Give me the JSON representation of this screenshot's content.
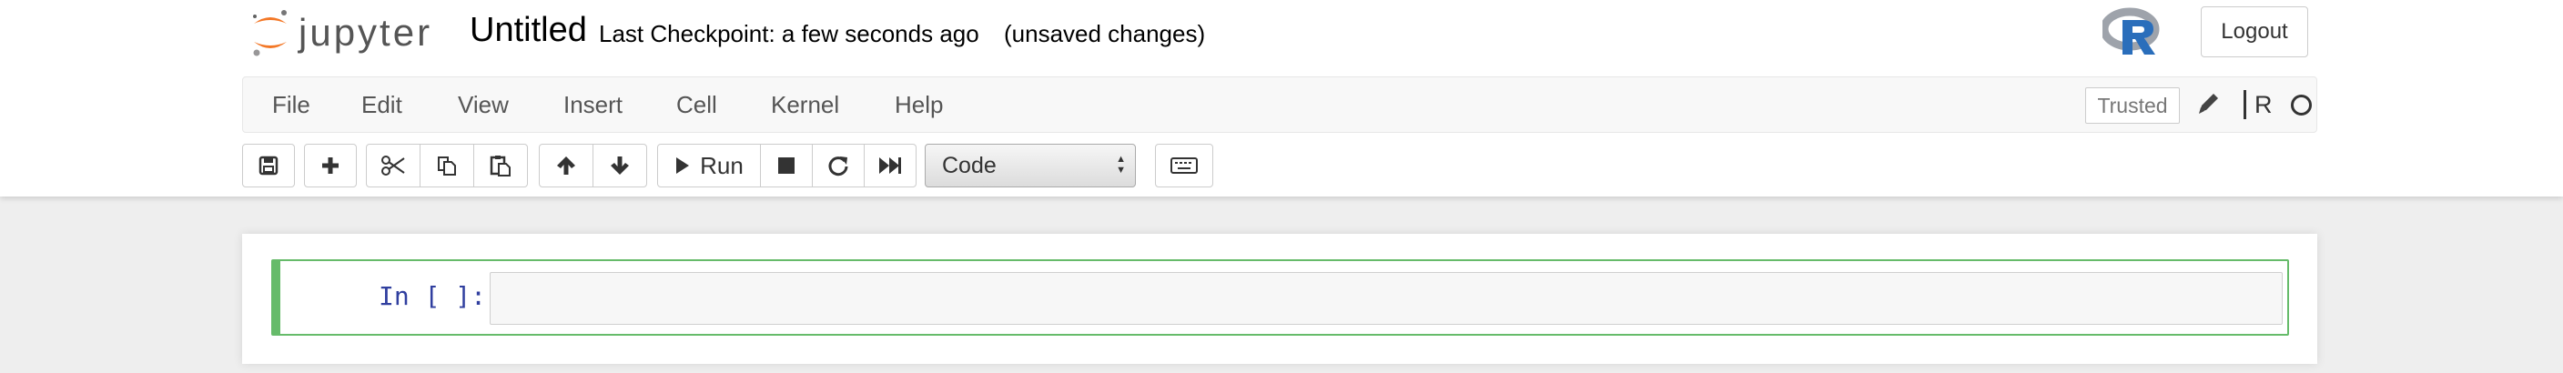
{
  "header": {
    "logo_text": "jupyter",
    "notebook_name": "Untitled",
    "checkpoint": "Last Checkpoint: a few seconds ago",
    "autosave_status": "(unsaved changes)",
    "kernel_logo": "r-logo-icon",
    "logout_label": "Logout"
  },
  "menubar": {
    "items": [
      "File",
      "Edit",
      "View",
      "Insert",
      "Cell",
      "Kernel",
      "Help"
    ],
    "trusted_label": "Trusted",
    "kernel_name": "R"
  },
  "toolbar": {
    "buttons": [
      "save-icon",
      "plus-icon",
      "cut-icon",
      "copy-icon",
      "paste-icon",
      "arrow-up-icon",
      "arrow-down-icon",
      "run-icon",
      "stop-icon",
      "restart-icon",
      "fast-forward-icon",
      "keyboard-icon"
    ],
    "run_label": "Run",
    "cell_type": "Code"
  },
  "cell": {
    "prompt": "In [ ]:",
    "input": ""
  },
  "colors": {
    "accent_orange": "#f37726",
    "cell_selected_border": "#66bb6a",
    "prompt_color": "#303f9f"
  }
}
